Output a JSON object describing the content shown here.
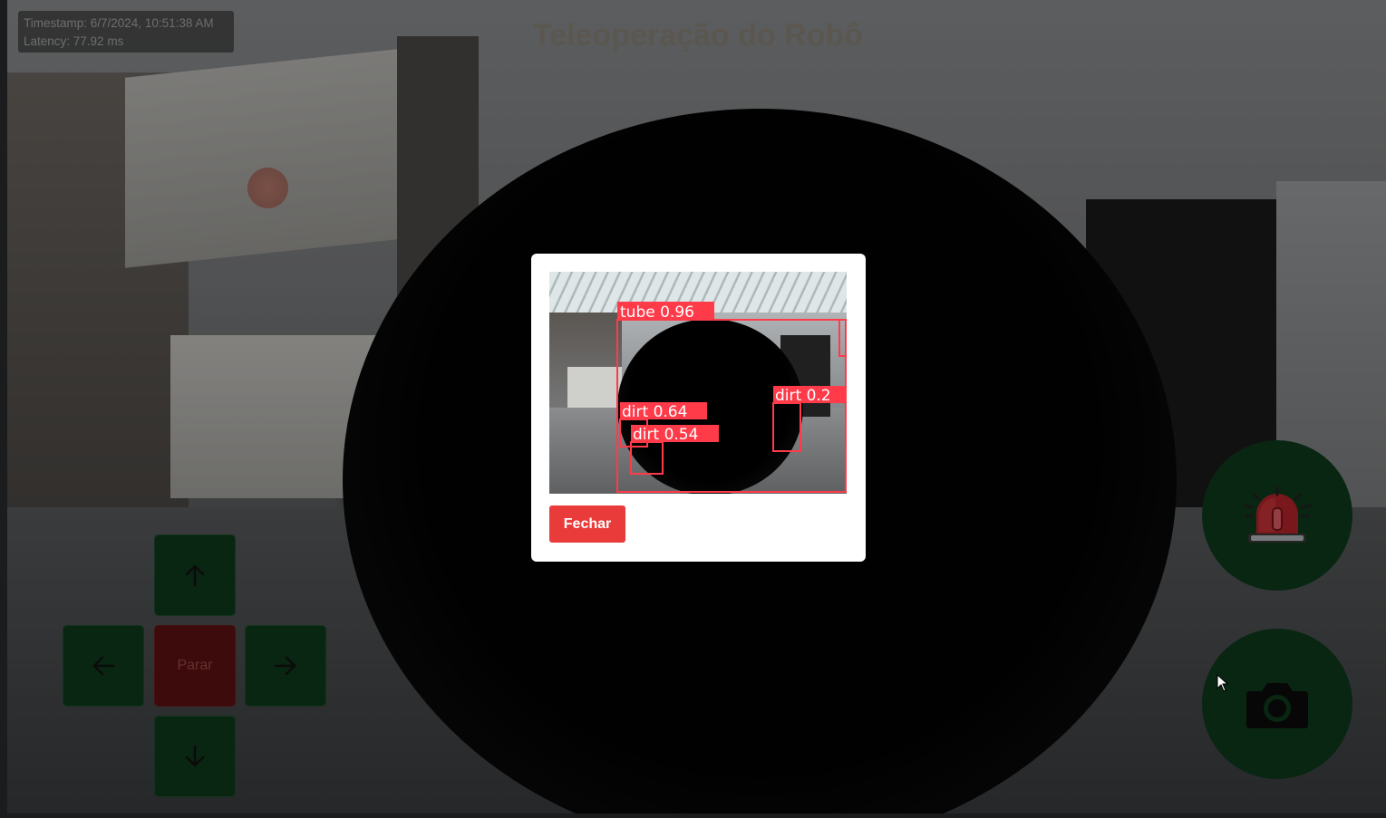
{
  "header": {
    "title": "Teleoperação do Robô"
  },
  "telemetry": {
    "timestamp": "Timestamp: 6/7/2024, 10:51:38 AM",
    "latency": "Latency: 77.92 ms"
  },
  "controls": {
    "up_icon": "arrow-up-icon",
    "left_icon": "arrow-left-icon",
    "right_icon": "arrow-right-icon",
    "down_icon": "arrow-down-icon",
    "stop_label": "Parar",
    "alarm_icon": "siren-icon",
    "camera_icon": "camera-icon"
  },
  "modal": {
    "detections": [
      {
        "label": "tube 0.96"
      },
      {
        "label": "dirt 0.64"
      },
      {
        "label": "dirt 0.54"
      },
      {
        "label": "dirt 0.2"
      }
    ],
    "close_label": "Fechar"
  },
  "colors": {
    "control_green": "#0f3b1c",
    "stop_red": "#5e1212",
    "close_button": "#ea3b3b",
    "detection_box": "#ff3b4a"
  }
}
